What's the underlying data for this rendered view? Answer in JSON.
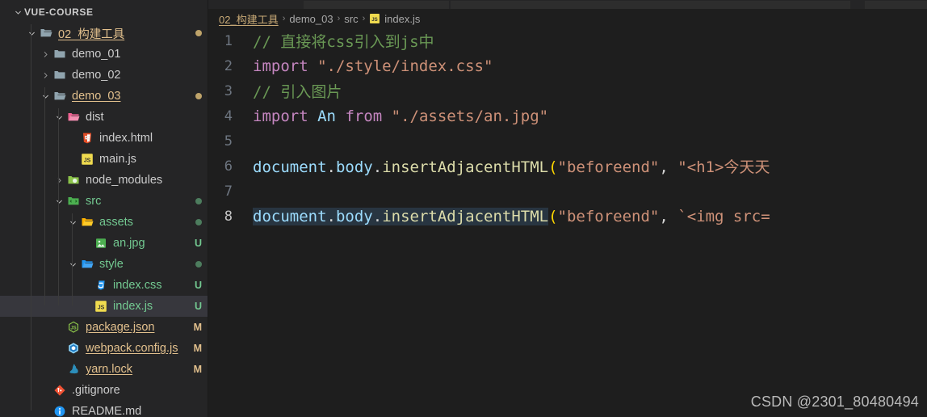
{
  "window": {
    "theme": "dark",
    "colors": {
      "sidebar_bg": "#252526",
      "editor_bg": "#1e1e1e",
      "selection_bg": "#37373d",
      "modified": "#e2c08d",
      "untracked": "#73c991",
      "comment": "#6a9955",
      "keyword": "#c586c0",
      "string": "#ce9178",
      "variable": "#9cdcfe",
      "function": "#dcdcaa"
    }
  },
  "sidebar": {
    "root_label": "VUE-COURSE",
    "items": [
      {
        "label": "VUE-COURSE",
        "kind": "root",
        "indent": 0,
        "twisty": "down",
        "icon": "none",
        "status": "",
        "state": "normal",
        "selected": false
      },
      {
        "label": "02_构建工具",
        "kind": "folder",
        "indent": 1,
        "twisty": "down",
        "icon": "folder-open",
        "status": "dot-modified",
        "state": "modified",
        "selected": false
      },
      {
        "label": "demo_01",
        "kind": "folder",
        "indent": 2,
        "twisty": "right",
        "icon": "folder",
        "status": "",
        "state": "normal",
        "selected": false
      },
      {
        "label": "demo_02",
        "kind": "folder",
        "indent": 2,
        "twisty": "right",
        "icon": "folder",
        "status": "",
        "state": "normal",
        "selected": false
      },
      {
        "label": "demo_03",
        "kind": "folder",
        "indent": 2,
        "twisty": "down",
        "icon": "folder-open",
        "status": "dot-modified",
        "state": "modified",
        "selected": false
      },
      {
        "label": "dist",
        "kind": "folder",
        "indent": 3,
        "twisty": "down",
        "icon": "folder-dist",
        "status": "",
        "state": "normal",
        "selected": false
      },
      {
        "label": "index.html",
        "kind": "file",
        "indent": 4,
        "twisty": "none",
        "icon": "html5",
        "status": "",
        "state": "normal",
        "selected": false
      },
      {
        "label": "main.js",
        "kind": "file",
        "indent": 4,
        "twisty": "none",
        "icon": "js",
        "status": "",
        "state": "normal",
        "selected": false
      },
      {
        "label": "node_modules",
        "kind": "folder",
        "indent": 3,
        "twisty": "right",
        "icon": "folder-node",
        "status": "",
        "state": "normal",
        "selected": false
      },
      {
        "label": "src",
        "kind": "folder",
        "indent": 3,
        "twisty": "down",
        "icon": "folder-src",
        "status": "dot-untracked",
        "state": "untracked",
        "selected": false
      },
      {
        "label": "assets",
        "kind": "folder",
        "indent": 4,
        "twisty": "down",
        "icon": "folder-assets",
        "status": "dot-untracked",
        "state": "untracked",
        "selected": false
      },
      {
        "label": "an.jpg",
        "kind": "file",
        "indent": 5,
        "twisty": "none",
        "icon": "image",
        "status": "U",
        "state": "untracked",
        "selected": false
      },
      {
        "label": "style",
        "kind": "folder",
        "indent": 4,
        "twisty": "down",
        "icon": "folder-style",
        "status": "dot-untracked",
        "state": "untracked",
        "selected": false
      },
      {
        "label": "index.css",
        "kind": "file",
        "indent": 5,
        "twisty": "none",
        "icon": "css3",
        "status": "U",
        "state": "untracked",
        "selected": false
      },
      {
        "label": "index.js",
        "kind": "file",
        "indent": 5,
        "twisty": "none",
        "icon": "js",
        "status": "U",
        "state": "untracked",
        "selected": true
      },
      {
        "label": "package.json",
        "kind": "file",
        "indent": 3,
        "twisty": "none",
        "icon": "nodejs",
        "status": "M",
        "state": "modified",
        "selected": false
      },
      {
        "label": "webpack.config.js",
        "kind": "file",
        "indent": 3,
        "twisty": "none",
        "icon": "webpack",
        "status": "M",
        "state": "modified",
        "selected": false
      },
      {
        "label": "yarn.lock",
        "kind": "file",
        "indent": 3,
        "twisty": "none",
        "icon": "yarn",
        "status": "M",
        "state": "modified",
        "selected": false
      },
      {
        "label": ".gitignore",
        "kind": "file",
        "indent": 2,
        "twisty": "none",
        "icon": "git",
        "status": "",
        "state": "normal",
        "selected": false
      },
      {
        "label": "README.md",
        "kind": "file",
        "indent": 2,
        "twisty": "none",
        "icon": "info",
        "status": "",
        "state": "normal",
        "selected": false
      }
    ]
  },
  "breadcrumb": {
    "separator": "›",
    "crumbs": [
      {
        "label": "02_构建工具",
        "icon": "none"
      },
      {
        "label": "demo_03",
        "icon": "none"
      },
      {
        "label": "src",
        "icon": "none"
      },
      {
        "label": "index.js",
        "icon": "js"
      }
    ]
  },
  "editor": {
    "active_line": 8,
    "lines": [
      {
        "number": "1",
        "tokens": [
          {
            "t": "// 直接将css引入到js中",
            "c": "comment"
          }
        ]
      },
      {
        "number": "2",
        "tokens": [
          {
            "t": "import",
            "c": "keyword"
          },
          {
            "t": " ",
            "c": "plain"
          },
          {
            "t": "\"./style/index.css\"",
            "c": "string"
          }
        ]
      },
      {
        "number": "3",
        "tokens": [
          {
            "t": "// 引入图片",
            "c": "comment"
          }
        ]
      },
      {
        "number": "4",
        "tokens": [
          {
            "t": "import",
            "c": "keyword"
          },
          {
            "t": " ",
            "c": "plain"
          },
          {
            "t": "An",
            "c": "variable"
          },
          {
            "t": " ",
            "c": "plain"
          },
          {
            "t": "from",
            "c": "keyword"
          },
          {
            "t": " ",
            "c": "plain"
          },
          {
            "t": "\"./assets/an.jpg\"",
            "c": "string"
          }
        ]
      },
      {
        "number": "5",
        "tokens": []
      },
      {
        "number": "6",
        "tokens": [
          {
            "t": "document",
            "c": "variable"
          },
          {
            "t": ".",
            "c": "plain"
          },
          {
            "t": "body",
            "c": "variable"
          },
          {
            "t": ".",
            "c": "plain"
          },
          {
            "t": "insertAdjacentHTML",
            "c": "function"
          },
          {
            "t": "(",
            "c": "paren"
          },
          {
            "t": "\"beforeend\"",
            "c": "string"
          },
          {
            "t": ",",
            "c": "plain"
          },
          {
            "t": " ",
            "c": "plain"
          },
          {
            "t": "\"<h1>今天天",
            "c": "string"
          }
        ]
      },
      {
        "number": "7",
        "tokens": []
      },
      {
        "number": "8",
        "tokens": [
          {
            "t": "document",
            "c": "variable"
          },
          {
            "t": ".",
            "c": "plain"
          },
          {
            "t": "body",
            "c": "variable"
          },
          {
            "t": ".",
            "c": "plain"
          },
          {
            "t": "insertAdjacentHTML",
            "c": "function"
          },
          {
            "t": "(",
            "c": "paren"
          },
          {
            "t": "\"beforeend\"",
            "c": "string"
          },
          {
            "t": ",",
            "c": "plain"
          },
          {
            "t": " ",
            "c": "plain"
          },
          {
            "t": "`<img src=",
            "c": "string"
          }
        ]
      }
    ]
  },
  "watermark": {
    "text": "CSDN @2301_80480494"
  }
}
